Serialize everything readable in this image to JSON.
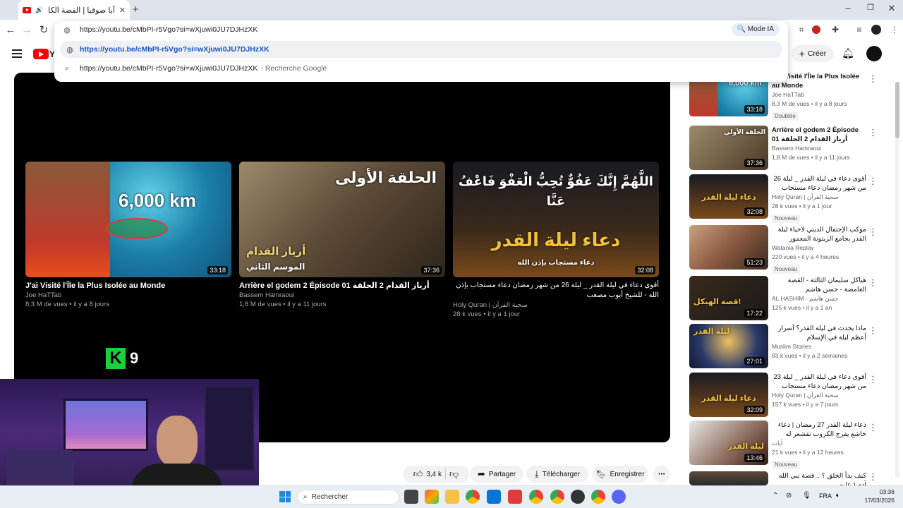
{
  "browser": {
    "tab_title": "آيا صوفيا | القصة الكاملة وتا",
    "url": "https://youtu.be/cMbPI-r5Vgo?si=wXjuwi0JU7DJHzXK",
    "omnibox": {
      "input_value": "https://youtu.be/cMbPI-r5Vgo?si=wXjuwi0JU7DJHzXK",
      "mode_ia_label": "Mode IA",
      "suggestion_url": "https://youtu.be/cMbPI-r5Vgo?si=wXjuwi0JU7DJHzXK",
      "search_suggestion": "https://youtu.be/cMbPI-r5Vgo?si=wXjuwi0JU7DJHzXK",
      "search_engine_label": "- Recherche Google"
    }
  },
  "youtube": {
    "create_label": "Créer",
    "logo_text": "Yo",
    "end_cards": [
      {
        "title": "J'ai Visité l'Île la Plus Isolée au Monde",
        "channel": "Joe HaTTab",
        "meta": "8,3 M de vues • il y a 8 jours",
        "duration": "33:18",
        "thumb_text": "6,000 km"
      },
      {
        "title": "Arrière el godem 2 Épisode 01 أرياز القدام 2 الحلقة",
        "channel": "Bassem Hamraoui",
        "meta": "1,8 M de vues • il y a 11 jours",
        "duration": "37:36",
        "thumb_text": "الحلقة الأولى",
        "thumb_text2": "أرياز القدام",
        "thumb_text3": "الموسم الثاني"
      },
      {
        "title": "أقوى دعاء في ليلة القدر _ ليلة 26 من شهر رمضان دعاء مستجاب بإذن الله - للشيخ أيوب مصعب",
        "channel": "Holy Quran | سحبة القرآن",
        "meta": "28 k vues • il y a 1 jour",
        "duration": "32:08",
        "thumb_text": "اللَّهُمَّ إِنَّكَ عَفُوٌّ تُحِبُّ الْعَفْوَ فَاعْفُ عَنَّا",
        "thumb_text2": "دعاء ليلة القدر",
        "thumb_text3": "دعاء مستجاب بإذن الله"
      }
    ],
    "overlay_logo": {
      "letter": "K",
      "number": "9"
    },
    "actions": {
      "likes": "3,4 k",
      "share": "Partager",
      "download": "Télécharger",
      "save": "Enregistrer"
    },
    "sidebar": [
      {
        "title": "J'ai Visité l'Île la Plus Isolée au Monde",
        "channel": "Joe HaTTab",
        "meta": "8,3 M de vues • il y a 8 jours",
        "duration": "33:18",
        "badge": "Doublée",
        "rtl": false,
        "thumb_text": "6,000 km"
      },
      {
        "title": "Arrière el godem 2 Épisode 01 أرياز القدام 2 الحلقة",
        "channel": "Bassem Hamraoui",
        "meta": "1,8 M de vues • il y a 11 jours",
        "duration": "37:36",
        "badge": "",
        "rtl": false,
        "thumb_text": "الحلقة الأولى"
      },
      {
        "title": "أقوى دعاء في ليلة القدر _ ليلة 26 من شهر رمضان دعاء مستجاب بإذن الله - للشيخ ...",
        "channel": "Holy Quran | سحبة القرآن",
        "meta": "28 k vues • il y a 1 jour",
        "duration": "32:08",
        "badge": "Nouveau",
        "rtl": true,
        "thumb_text": "دعاء ليلة القدر"
      },
      {
        "title": "موكب الإحتفال الديني لاحياء ليلة القدر بجامع الزيتونة المعمور",
        "channel": "Watania Replay",
        "meta": "220 vues • il y a 4 heures",
        "duration": "51:23",
        "badge": "Nouveau",
        "rtl": true,
        "thumb_text": ""
      },
      {
        "title": "هياكل سليمان الثالثة - القصة الغامضة - حسن هاشم",
        "channel": "AL HASHIM - حسن هاشم",
        "meta": "125 k vues • il y a 1 an",
        "duration": "17:22",
        "badge": "",
        "rtl": true,
        "thumb_text": "قصة الهيكل!"
      },
      {
        "title": "ماذا يحدث في ليلة القدر؟ أسرار أعظم ليلة في الإسلام",
        "channel": "Muslim Stories",
        "meta": "83 k vues • il y a 2 semaines",
        "duration": "27:01",
        "badge": "",
        "rtl": true,
        "thumb_text": "ليلة القدر"
      },
      {
        "title": "أقوى دعاء في ليلة القدر _ ليلة 23 من شهر رمضان دعاء مستجاب بإذن الله - للشيخ",
        "channel": "Holy Quran | سحبة القرآن",
        "meta": "157 k vues • il y a 7 jours",
        "duration": "32:09",
        "badge": "",
        "rtl": true,
        "thumb_text": "دعاء ليلة القدر"
      },
      {
        "title": "دعاء ليلة القدر 27 رمضان | دعاء خاشع يفرج الكروب تقشعر له الأبدان | الشيخ",
        "channel": "أيات",
        "meta": "21 k vues • il y a 12 heures",
        "duration": "13:46",
        "badge": "Nouveau",
        "rtl": true,
        "thumb_text": "ليلة القدر"
      },
      {
        "title": "كيف بدأ الخلق ؟ .. قصة نبي الله آدم ( عليه ...",
        "channel": "",
        "meta": "",
        "duration": "",
        "badge": "",
        "rtl": true,
        "thumb_text": ""
      }
    ]
  },
  "taskbar": {
    "search_label": "Rechercher",
    "lang": "FRA",
    "time": "03:36",
    "date": "17/03/2026"
  }
}
